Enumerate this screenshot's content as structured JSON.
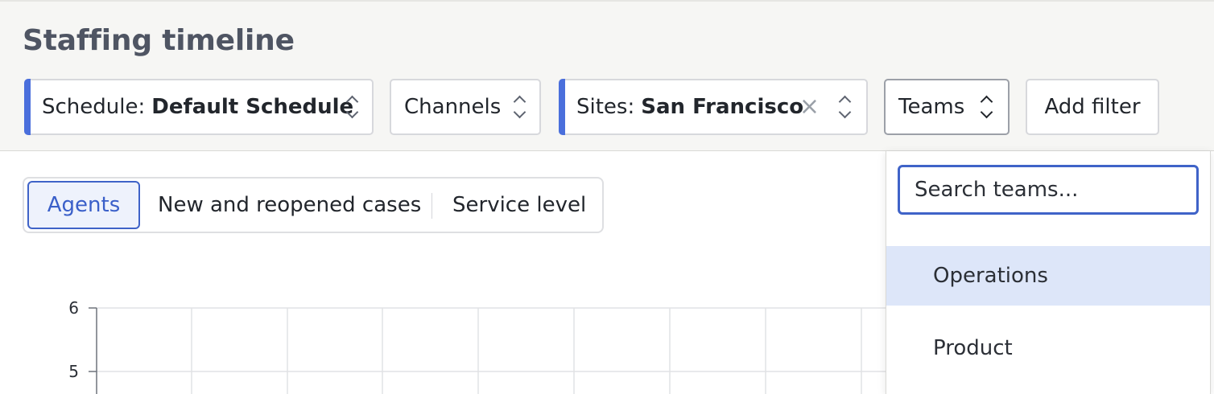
{
  "page": {
    "title": "Staffing timeline"
  },
  "filters": {
    "schedule": {
      "label": "Schedule:",
      "value": "Default Schedule"
    },
    "channels": {
      "label": "Channels"
    },
    "sites": {
      "label": "Sites:",
      "value": "San Francisco",
      "clear": "×"
    },
    "teams": {
      "label": "Teams"
    },
    "add": {
      "label": "Add filter"
    }
  },
  "view_tabs": {
    "items": [
      "Agents",
      "New and reopened cases",
      "Service level"
    ],
    "selected": "Agents"
  },
  "chart_data": {
    "type": "line",
    "y_ticks": [
      "6",
      "5"
    ],
    "grid": true,
    "series": []
  },
  "teams_dropdown": {
    "search_placeholder": "Search teams...",
    "options": [
      "Operations",
      "Product"
    ],
    "highlighted": "Operations"
  },
  "colors": {
    "accent": "#3f63c8",
    "active_filter_bar": "#4a6fdc",
    "highlight": "#dde6f9"
  }
}
